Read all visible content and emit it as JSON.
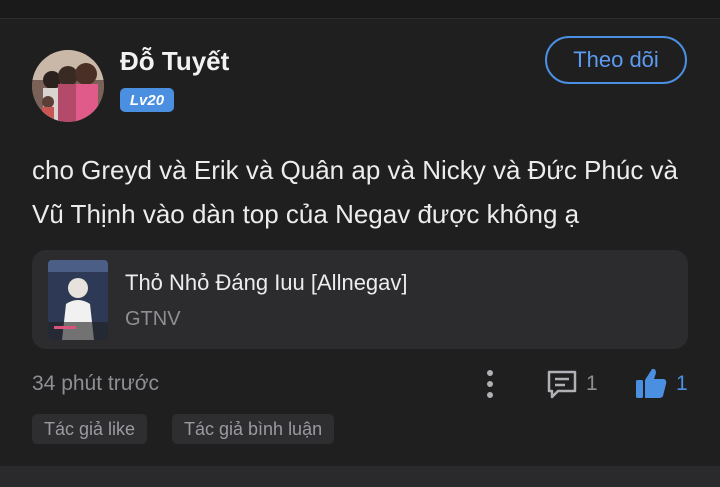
{
  "comment": {
    "user": {
      "name": "Đỗ Tuyết",
      "level": "Lv20",
      "avatar_icon": "user-avatar-photo"
    },
    "follow_label": "Theo dõi",
    "text": "cho Greyd và Erik và Quân ap và Nicky và Đức Phúc và Vũ Thịnh vào dàn top của Negav được không ạ",
    "story": {
      "title": "Thỏ Nhỏ Đáng Iuu [Allnegav]",
      "author": "GTNV",
      "cover_icon": "story-cover-image"
    },
    "timestamp": "34 phút trước",
    "reply_count": "1",
    "like_count": "1",
    "tags": [
      "Tác giả like",
      "Tác giả bình luận"
    ]
  },
  "colors": {
    "accent": "#4a8fe0",
    "background": "#1f1f20",
    "card": "#2c2c2e",
    "muted_text": "#8e8e93"
  }
}
